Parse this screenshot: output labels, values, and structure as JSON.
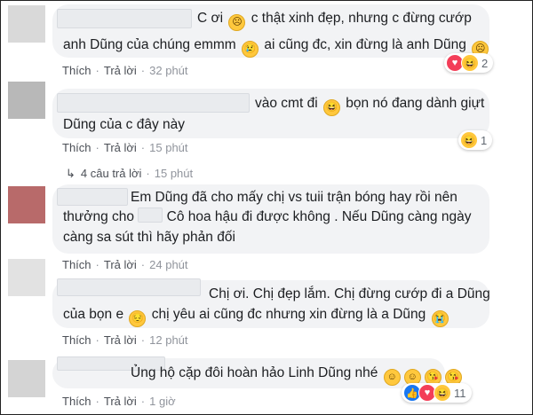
{
  "comments": [
    {
      "name_hidden": true,
      "line1": "C ơi",
      "line1b": "c thật xinh đẹp, nhưng c đừng cướp",
      "line2": "anh Dũng của chúng emmm",
      "line2b": "ai cũng đc, xin đừng là anh Dũng",
      "like": "Thích",
      "reply": "Trả lời",
      "time": "32 phút",
      "reaction_count": "2"
    },
    {
      "name_hidden": true,
      "line1": "vào cmt đi",
      "line1b": "bọn nó đang dành giựt",
      "line2": "Dũng của c đây này",
      "like": "Thích",
      "reply": "Trả lời",
      "time": "15 phút",
      "reaction_count": "1",
      "replies": "4 câu trả lời",
      "replies_time": "15 phút"
    },
    {
      "name_hidden": true,
      "line1": "Em Dũng đã cho mấy chị vs tuii trận bóng hay rồi nên",
      "line2": "thưởng cho",
      "line2b": "Cô hoa hậu đi được không . Nếu Dũng càng ngày",
      "line3": "càng sa sút thì hãy phản đối",
      "like": "Thích",
      "reply": "Trả lời",
      "time": "24 phút"
    },
    {
      "name_hidden": true,
      "line1": "Chị ơi. Chị đẹp lắm. Chị đừng cướp đi a Dũng",
      "line2": "của bọn e",
      "line2b": "chị yêu ai cũng đc nhưng xin đừng là a Dũng",
      "like": "Thích",
      "reply": "Trả lời",
      "time": "12 phút"
    },
    {
      "name_hidden": true,
      "line1": "Ủng hộ cặp đôi hoàn hảo Linh Dũng nhé",
      "like": "Thích",
      "reply": "Trả lời",
      "time": "1 giờ",
      "reaction_count": "11"
    }
  ],
  "separator": "·",
  "icons": {
    "sad": "sad-emoji-icon",
    "cry": "crying-emoji-icon",
    "laugh": "laughing-emoji-icon",
    "pensive": "pensive-emoji-icon",
    "smile": "smiling-emoji-icon",
    "kiss": "kissing-emoji-icon",
    "like": "like-reaction-icon",
    "love": "love-reaction-icon",
    "haha": "haha-reaction-icon"
  },
  "colors": {
    "bubble": "#f2f3f5",
    "meta": "#90949c",
    "like_blue": "#1877f2",
    "love_red": "#f33e58"
  }
}
